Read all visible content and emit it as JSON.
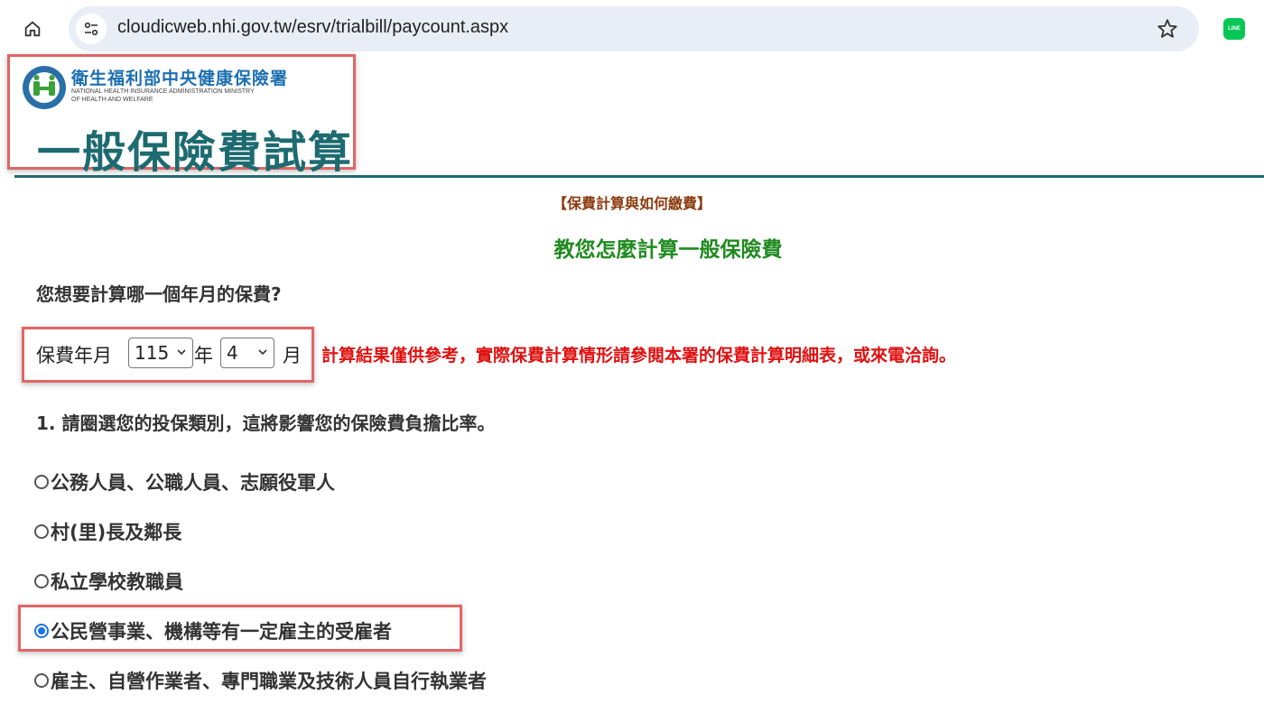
{
  "browser": {
    "url": "cloudicweb.nhi.gov.tw/esrv/trialbill/paycount.aspx",
    "extension_label": "LINE"
  },
  "header": {
    "org_name_cn": "衛生福利部中央健康保險署",
    "org_name_en_line1": "NATIONAL HEALTH INSURANCE ADMINISTRATION MINISTRY",
    "org_name_en_line2": "OF HEALTH AND WELFARE",
    "page_title": "一般保險費試算"
  },
  "main": {
    "calc_link": "【保費計算與如何繳費】",
    "subtitle": "教您怎麼計算一般保險費",
    "question": "您想要計算哪一個年月的保費?",
    "period": {
      "label": "保費年月",
      "year_value": "115",
      "year_unit": "年",
      "month_value": "4",
      "month_unit": "月"
    },
    "disclaimer": "計算結果僅供參考，實際保費計算情形請參閱本署的保費計算明細表，或來電洽詢。",
    "step1": "1. 請圈選您的投保類別，這將影響您的保險費負擔比率。",
    "options": [
      {
        "label": "公務人員、公職人員、志願役軍人",
        "checked": false
      },
      {
        "label": "村(里)長及鄰長",
        "checked": false
      },
      {
        "label": "私立學校教職員",
        "checked": false
      },
      {
        "label": "公民營事業、機構等有一定雇主的受雇者",
        "checked": true
      },
      {
        "label": "雇主、自營作業者、專門職業及技術人員自行執業者",
        "checked": false
      }
    ]
  },
  "colors": {
    "title_teal": "#1d6b71",
    "org_blue": "#1c6fb0",
    "link_brown": "#8b3a0e",
    "subtitle_green": "#1f8a1f",
    "disclaimer_red": "#e01010",
    "highlight_red": "#e06666",
    "radio_blue": "#1a73e8"
  },
  "icons": {
    "home": "home-icon",
    "site_info": "site-settings-icon",
    "bookmark": "star-icon",
    "extension": "line-icon",
    "logo": "nhi-logo-icon"
  }
}
